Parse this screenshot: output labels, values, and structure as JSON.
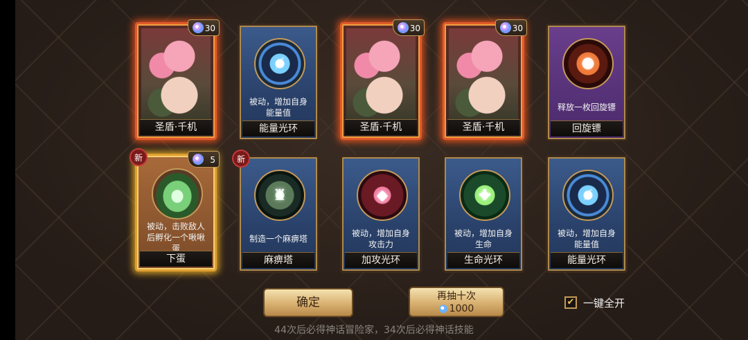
{
  "cards_row1": [
    {
      "type": "hero",
      "name": "圣盾·千机",
      "cost": "30"
    },
    {
      "type": "skill",
      "icon": "energy-ring-icon",
      "desc": "被动，增加自身能量值",
      "name": "能量光环"
    },
    {
      "type": "hero",
      "name": "圣盾·千机",
      "cost": "30"
    },
    {
      "type": "hero",
      "name": "圣盾·千机",
      "cost": "30"
    },
    {
      "type": "skill",
      "icon": "boomerang-icon",
      "desc": "释放一枚回旋镖",
      "name": "回旋镖"
    }
  ],
  "cards_row2": [
    {
      "type": "skill",
      "icon": "egg-icon",
      "desc": "被动，击败敌人后孵化一个啾啾蛋",
      "name": "下蛋",
      "cost": "5",
      "badge": "新"
    },
    {
      "type": "skill",
      "icon": "paralysis-tower-icon",
      "desc": "制造一个麻痹塔",
      "name": "麻痹塔",
      "badge": "新"
    },
    {
      "type": "skill",
      "icon": "attack-ring-icon",
      "desc": "被动，增加自身攻击力",
      "name": "加攻光环"
    },
    {
      "type": "skill",
      "icon": "life-ring-icon",
      "desc": "被动，增加自身生命",
      "name": "生命光环"
    },
    {
      "type": "skill",
      "icon": "energy-ring-icon",
      "desc": "被动，增加自身能量值",
      "name": "能量光环"
    }
  ],
  "buttons": {
    "confirm": "确定",
    "redraw_label": "再抽十次",
    "redraw_price": "1000"
  },
  "auto_open": {
    "label": "一键全开",
    "checked": true,
    "mark": "✔"
  },
  "footer": "44次后必得神话冒险家，34次后必得神话技能",
  "colors": {
    "accent": "#d8b070",
    "hero_glow": "#ff5a1e",
    "gold_glow": "#ffbe28"
  }
}
